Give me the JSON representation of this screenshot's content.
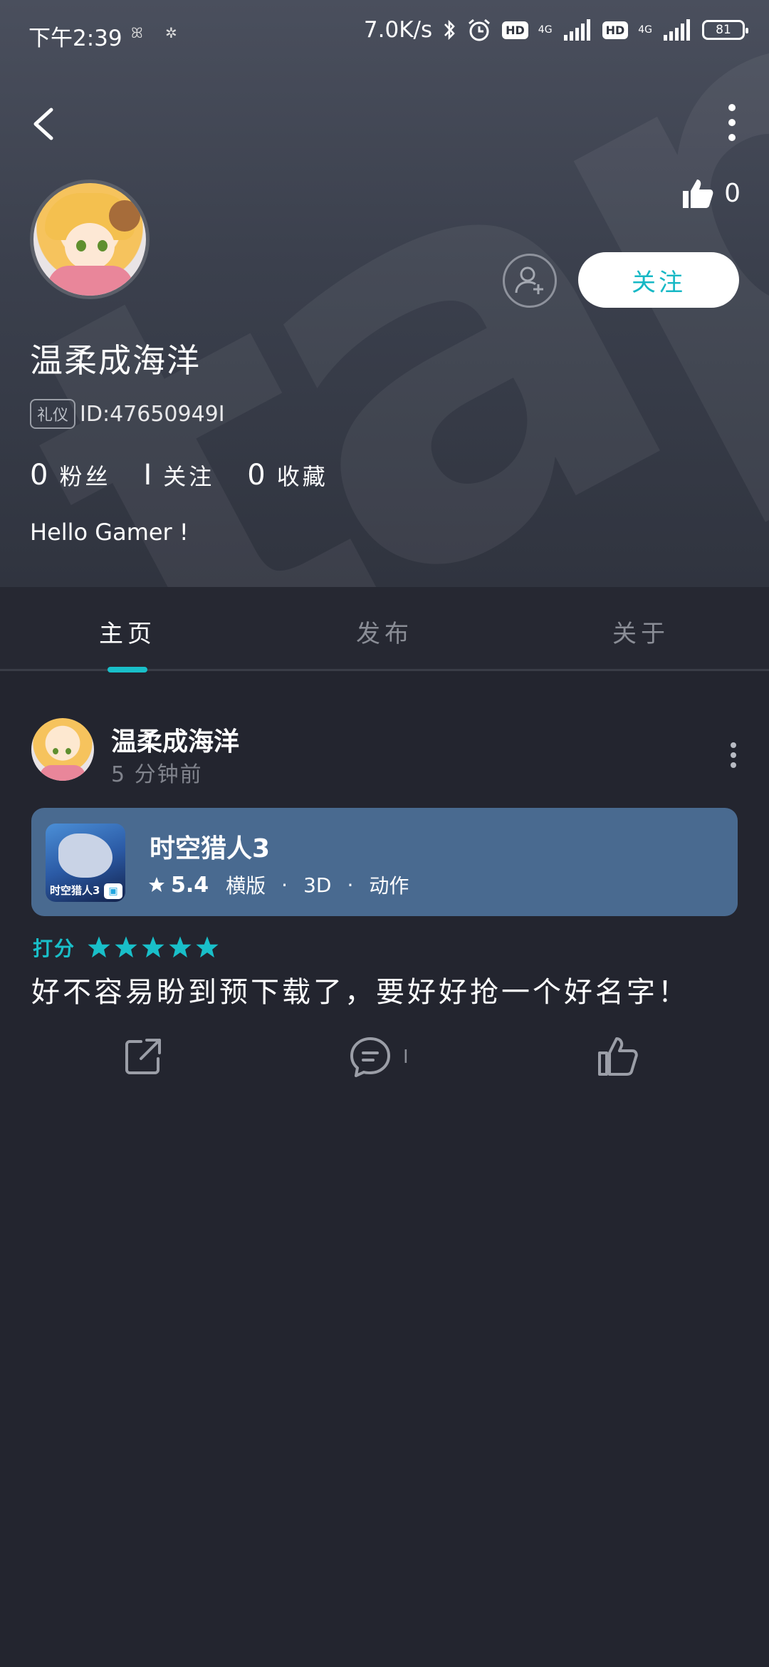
{
  "status_bar": {
    "time": "下午2:39",
    "speed": "7.0K/s",
    "hd1": "HD",
    "hd2": "HD",
    "net1": "4G",
    "net2": "4G",
    "battery": "81"
  },
  "profile": {
    "username": "温柔成海洋",
    "badge": "礼仪",
    "id_text": "ID:47650949I",
    "likes": "0",
    "follow_label": "关注",
    "stats": [
      {
        "num": "0",
        "label": "粉丝"
      },
      {
        "num": "I",
        "label": "关注"
      },
      {
        "num": "0",
        "label": "收藏"
      }
    ],
    "bio": "Hello Gamer !",
    "watermark": "tapTap"
  },
  "tabs": [
    {
      "label": "主页",
      "active": true
    },
    {
      "label": "发布",
      "active": false
    },
    {
      "label": "关于",
      "active": false
    }
  ],
  "post": {
    "author": "温柔成海洋",
    "time": "5 分钟前",
    "game": {
      "title": "时空猎人3",
      "score": "5.4",
      "tags": [
        "横版",
        "3D",
        "动作"
      ],
      "icon_text": "时空猎人3"
    },
    "rating_label": "打分",
    "rating_stars": 5,
    "text": "好不容易盼到预下载了，要好好抢一个好名字！",
    "comment_count": "I"
  },
  "colors": {
    "accent": "#19bfc9",
    "background": "#23252f",
    "card": "#496a90"
  },
  "icons": [
    "back-icon",
    "more-icon",
    "thumbs-up-icon",
    "add-friend-icon",
    "star-icon",
    "share-icon",
    "comment-icon",
    "like-icon"
  ]
}
